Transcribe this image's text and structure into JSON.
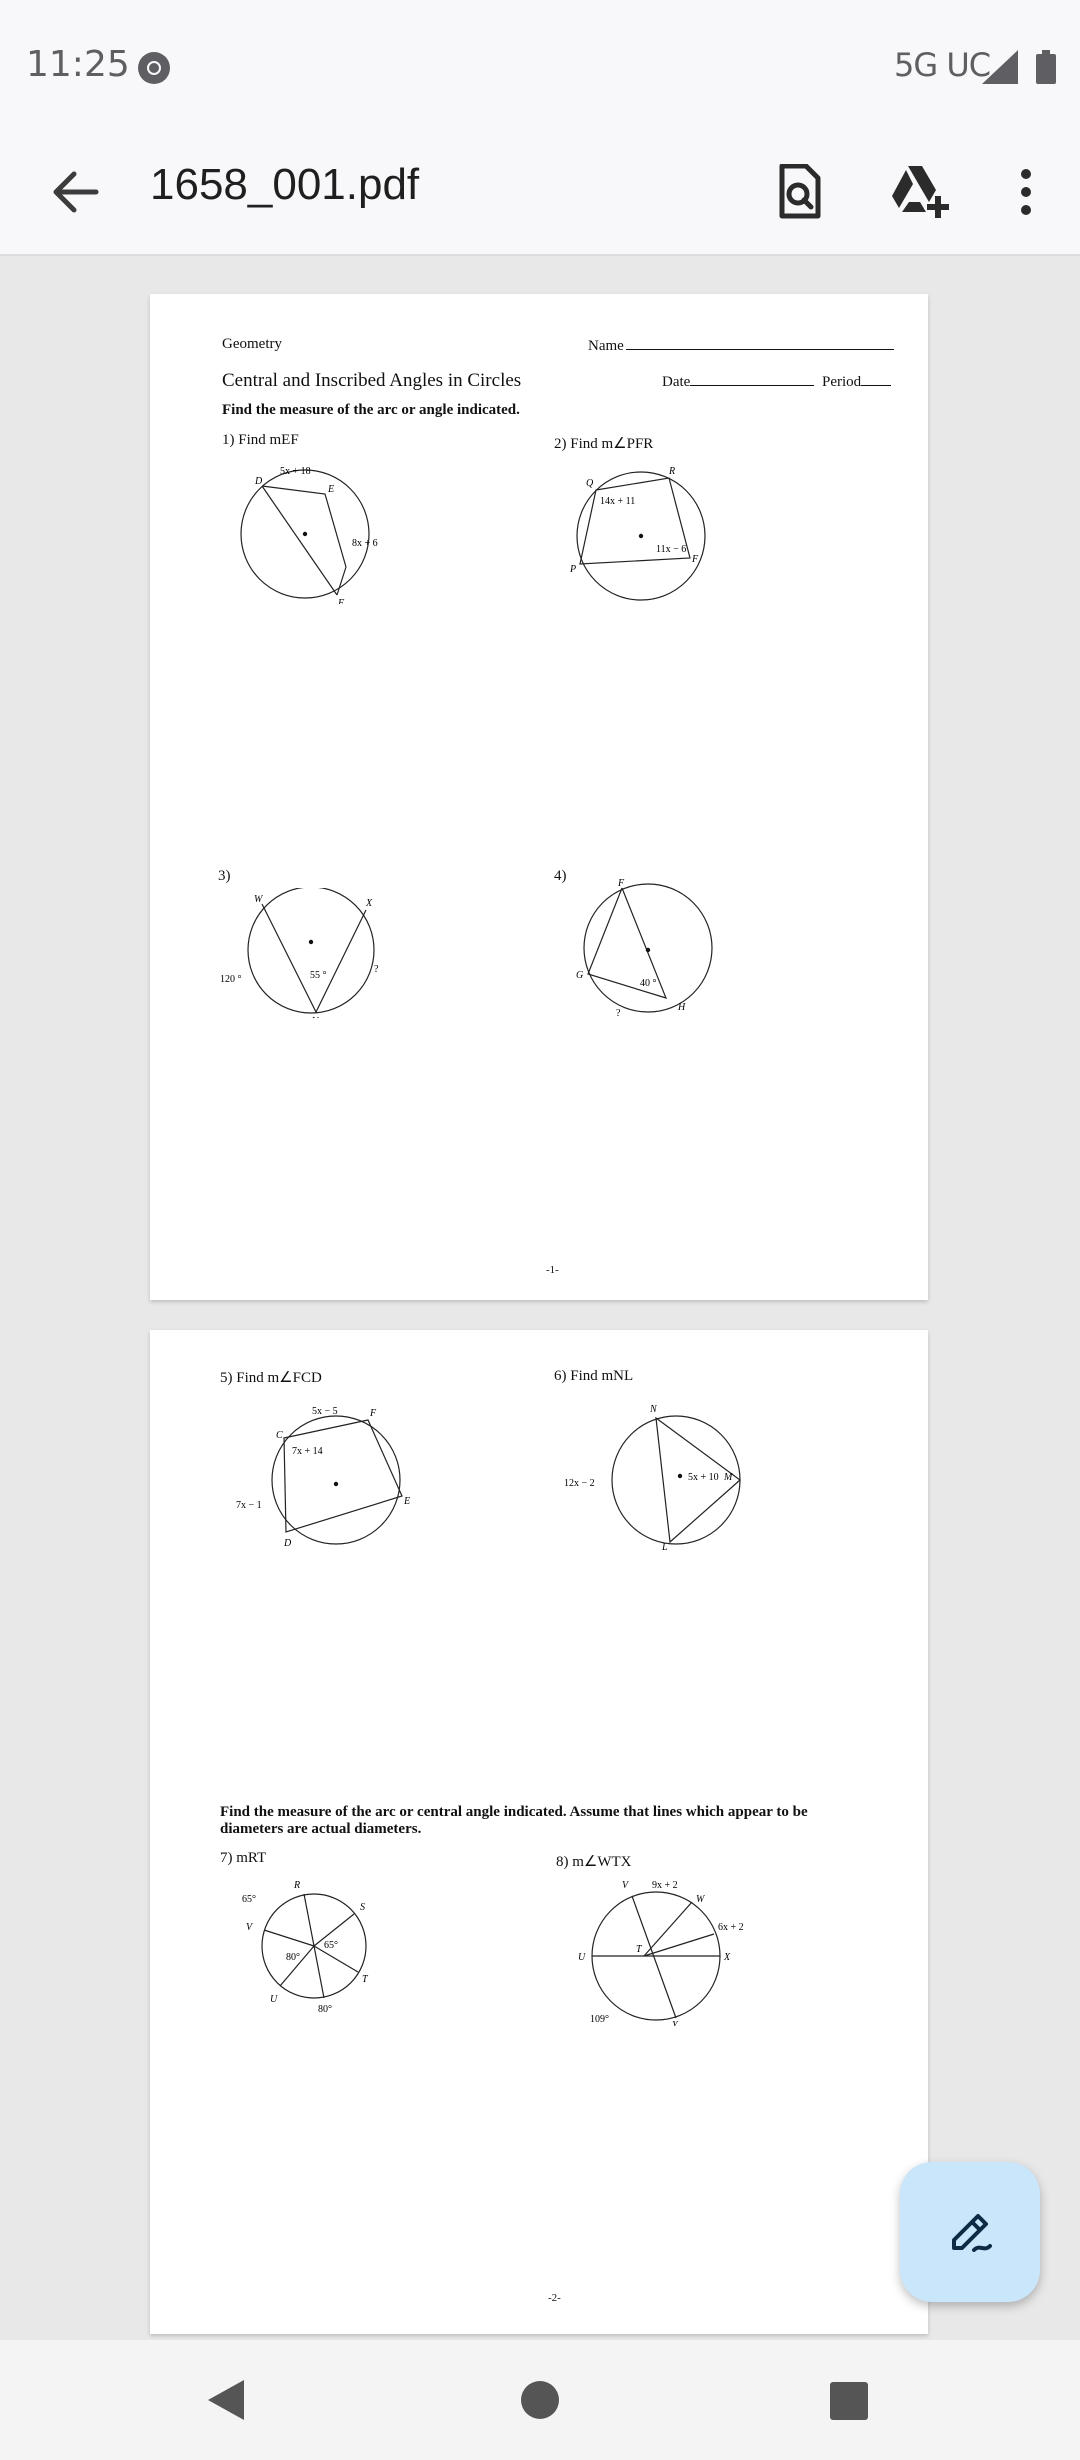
{
  "status_bar": {
    "time": "11:25",
    "network": "5G UC"
  },
  "app_bar": {
    "title": "1658_001.pdf"
  },
  "page1": {
    "subject": "Geometry",
    "name_label": "Name",
    "title": "Central and Inscribed Angles in Circles",
    "date_label": "Date",
    "period_label": "Period",
    "instruction": "Find the measure of the arc or angle indicated.",
    "q1": "1) Find mEF",
    "q2": "2) Find m∠PFR",
    "q3": "3)",
    "q4": "4)",
    "page_number": "-1-",
    "fig1": {
      "d": "D",
      "e": "E",
      "f": "F",
      "arc_top": "5x + 18",
      "arc_right": "8x + 6"
    },
    "fig2": {
      "q": "Q",
      "r": "R",
      "f": "F",
      "p": "P",
      "angle_q": "14x + 11",
      "angle_f": "11x − 6"
    },
    "fig3": {
      "w": "W",
      "x": "X",
      "v": "V",
      "arc_left": "120 °",
      "angle_v": "55 °",
      "unknown": "?"
    },
    "fig4": {
      "f": "F",
      "g": "G",
      "h": "H",
      "angle": "40 °",
      "unknown": "?"
    }
  },
  "page2": {
    "q5": "5) Find m∠FCD",
    "q6": "6) Find mNL",
    "instruction": "Find the measure of the arc or central angle indicated.  Assume that lines which appear to be diameters are actual diameters.",
    "q7": "7) mRT",
    "q8": "8) m∠WTX",
    "page_number": "-2-",
    "fig5": {
      "c": "C",
      "f": "F",
      "e": "E",
      "d": "D",
      "arc_top": "5x − 5",
      "angle_c": "7x + 14",
      "arc_left": "7x − 1"
    },
    "fig6": {
      "n": "N",
      "m": "M",
      "l": "L",
      "arc_left": "12x − 2",
      "angle": "5x + 10"
    },
    "fig7": {
      "r": "R",
      "s": "S",
      "t": "T",
      "u": "U",
      "v": "V",
      "arc_rv": "65°",
      "angle_rs": "65°",
      "angle_vu": "80°",
      "arc_ut": "80°"
    },
    "fig8": {
      "v": "V",
      "w": "W",
      "x": "X",
      "u": "U",
      "t": "T",
      "y": "Y",
      "arc_vw": "9x + 2",
      "arc_wx": "6x + 2",
      "arc_uy": "109°"
    }
  }
}
